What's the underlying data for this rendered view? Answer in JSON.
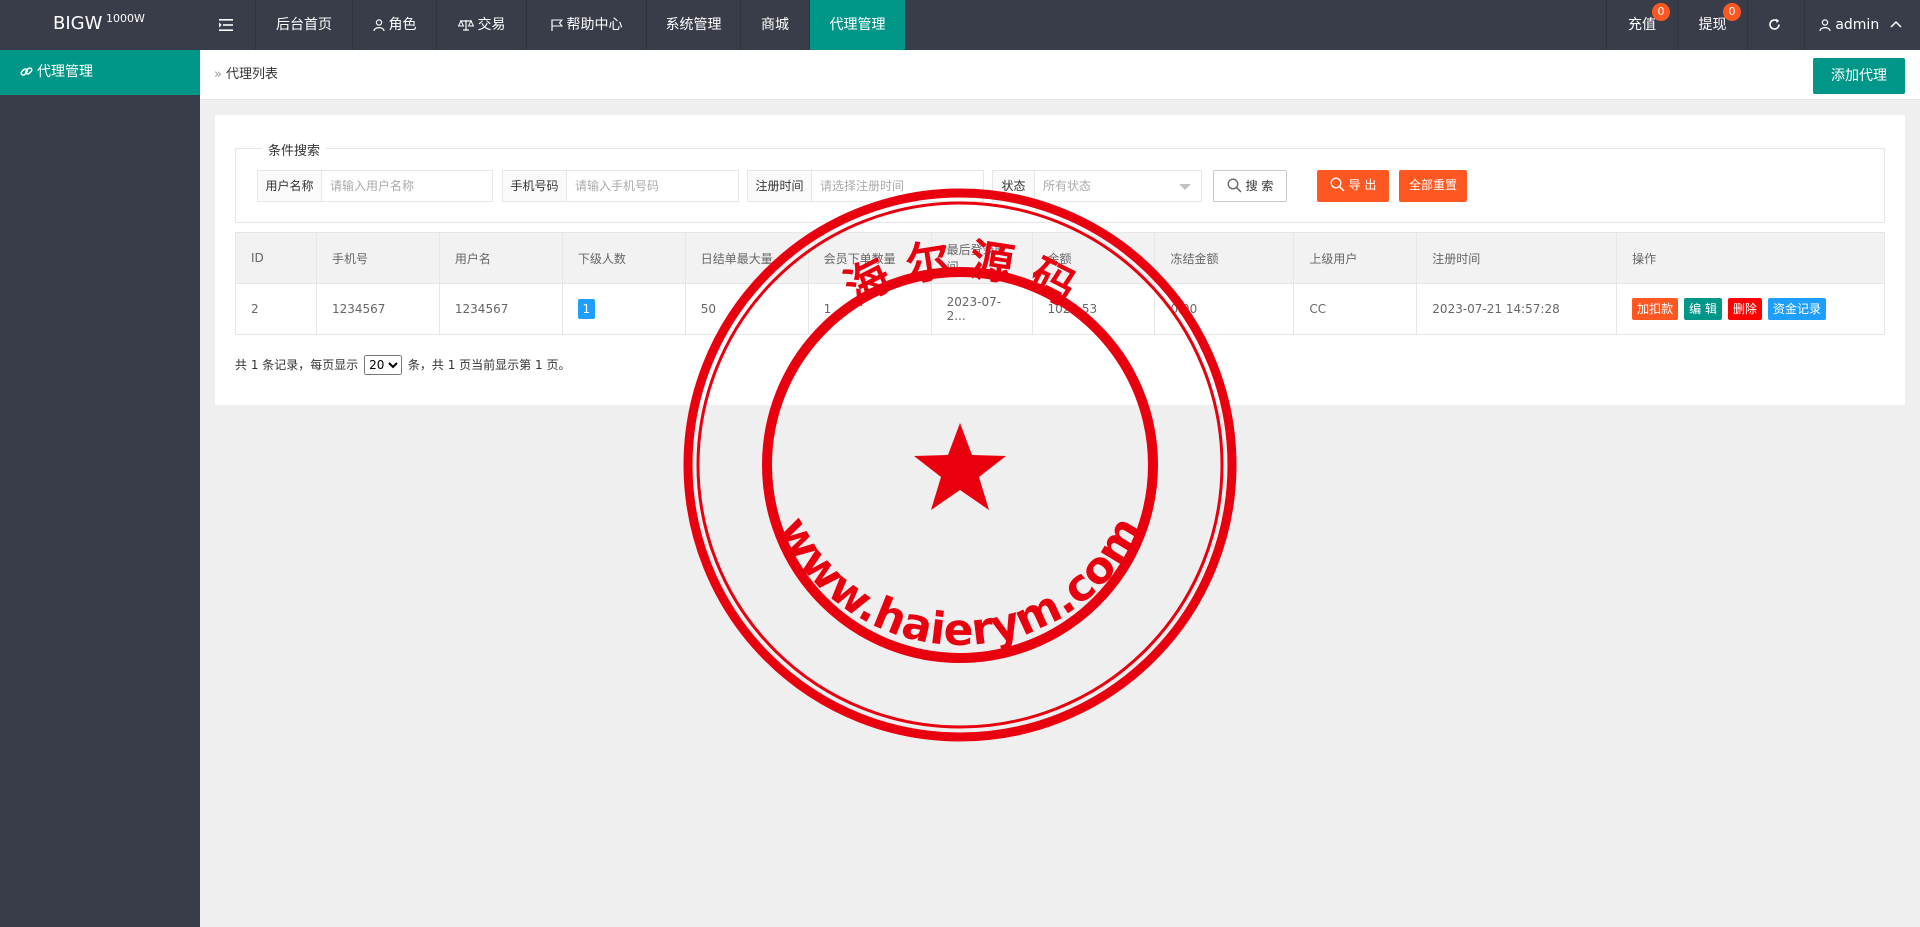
{
  "header": {
    "brand": "BIGW",
    "brand_sup": "1000W",
    "nav": [
      {
        "label": "后台首页"
      },
      {
        "label": "角色"
      },
      {
        "label": "交易"
      },
      {
        "label": "帮助中心"
      },
      {
        "label": "系统管理"
      },
      {
        "label": "商城"
      },
      {
        "label": "代理管理"
      }
    ],
    "recharge_label": "充值",
    "recharge_count": "0",
    "withdraw_label": "提现",
    "withdraw_count": "0",
    "user_label": "admin"
  },
  "sidebar": {
    "items": [
      {
        "label": "代理管理"
      }
    ]
  },
  "breadcrumb": {
    "current": "代理列表"
  },
  "toolbar": {
    "add_label": "添加代理"
  },
  "search": {
    "legend": "条件搜索",
    "username_label": "用户名称",
    "username_placeholder": "请输入用户名称",
    "phone_label": "手机号码",
    "phone_placeholder": "请输入手机号码",
    "regtime_label": "注册时间",
    "regtime_placeholder": "请选择注册时间",
    "status_label": "状态",
    "status_value": "所有状态",
    "search_label": "搜 索",
    "export_label": "导 出",
    "reset_label": "全部重置"
  },
  "table": {
    "headers": [
      "ID",
      "手机号",
      "用户名",
      "下级人数",
      "日结单最大量",
      "会员下单数量",
      "最后登录时间",
      "余额",
      "冻结金额",
      "上级用户",
      "注册时间",
      "操作"
    ],
    "rows": [
      {
        "id": "2",
        "phone": "1234567",
        "username": "1234567",
        "sub_count": "1",
        "daily_max": "50",
        "member_orders": "1",
        "last_login": "2023-07-2...",
        "balance": "1025.53",
        "frozen": "0.00",
        "parent": "CC",
        "reg_time": "2023-07-21 14:57:28",
        "actions": [
          "加扣款",
          "编 辑",
          "删除",
          "资金记录"
        ]
      }
    ]
  },
  "pager": {
    "prefix": "共 1 条记录，每页显示",
    "page_size": "20",
    "suffix": "条，共 1 页当前显示第 1 页。"
  },
  "watermark": {
    "top_text": "海 尔 源 码",
    "bottom_text": "www.haierym.com"
  },
  "colors": {
    "header_bg": "#393d49",
    "accent": "#009688",
    "danger": "#ff5722",
    "delete": "#ff0000",
    "info": "#1e9fff",
    "seal": "#e8000f"
  }
}
